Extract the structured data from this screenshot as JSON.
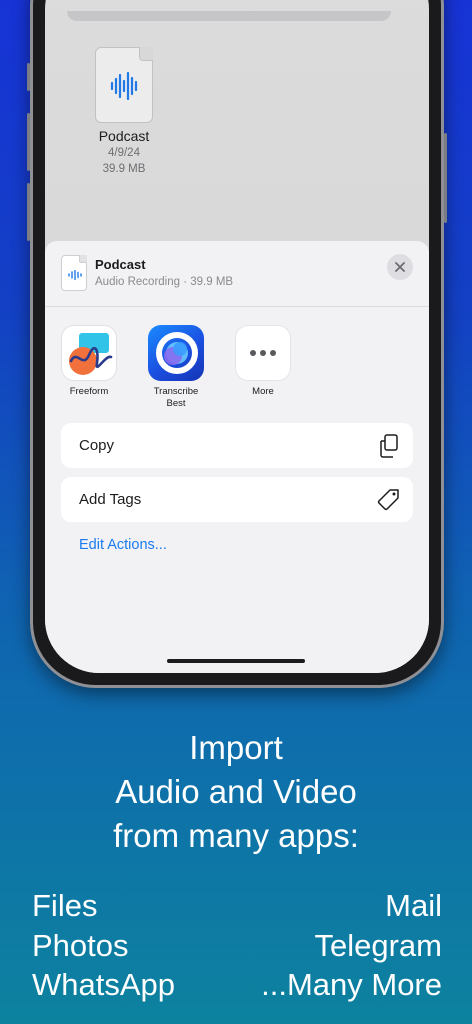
{
  "file": {
    "name": "Podcast",
    "date": "4/9/24",
    "size": "39.9 MB"
  },
  "share_sheet": {
    "title": "Podcast",
    "subtitle": "Audio Recording · 39.9 MB",
    "apps": [
      {
        "label": "Freeform",
        "icon": "freeform-icon"
      },
      {
        "label": "Transcribe Best",
        "icon": "transcribe-icon"
      },
      {
        "label": "More",
        "icon": "ellipsis-icon"
      }
    ],
    "actions": [
      {
        "label": "Copy",
        "icon": "copy-icon"
      },
      {
        "label": "Add Tags",
        "icon": "tag-icon"
      }
    ],
    "edit_actions": "Edit Actions..."
  },
  "promo": {
    "headline": [
      "Import",
      "Audio and Video",
      "from many apps:"
    ],
    "left_sources": [
      "Files",
      "Photos",
      "WhatsApp"
    ],
    "right_sources": [
      "Mail",
      "Telegram",
      "...Many More"
    ]
  },
  "colors": {
    "accent_link": "#1a7cf0",
    "waveform": "#1f7ae8"
  }
}
